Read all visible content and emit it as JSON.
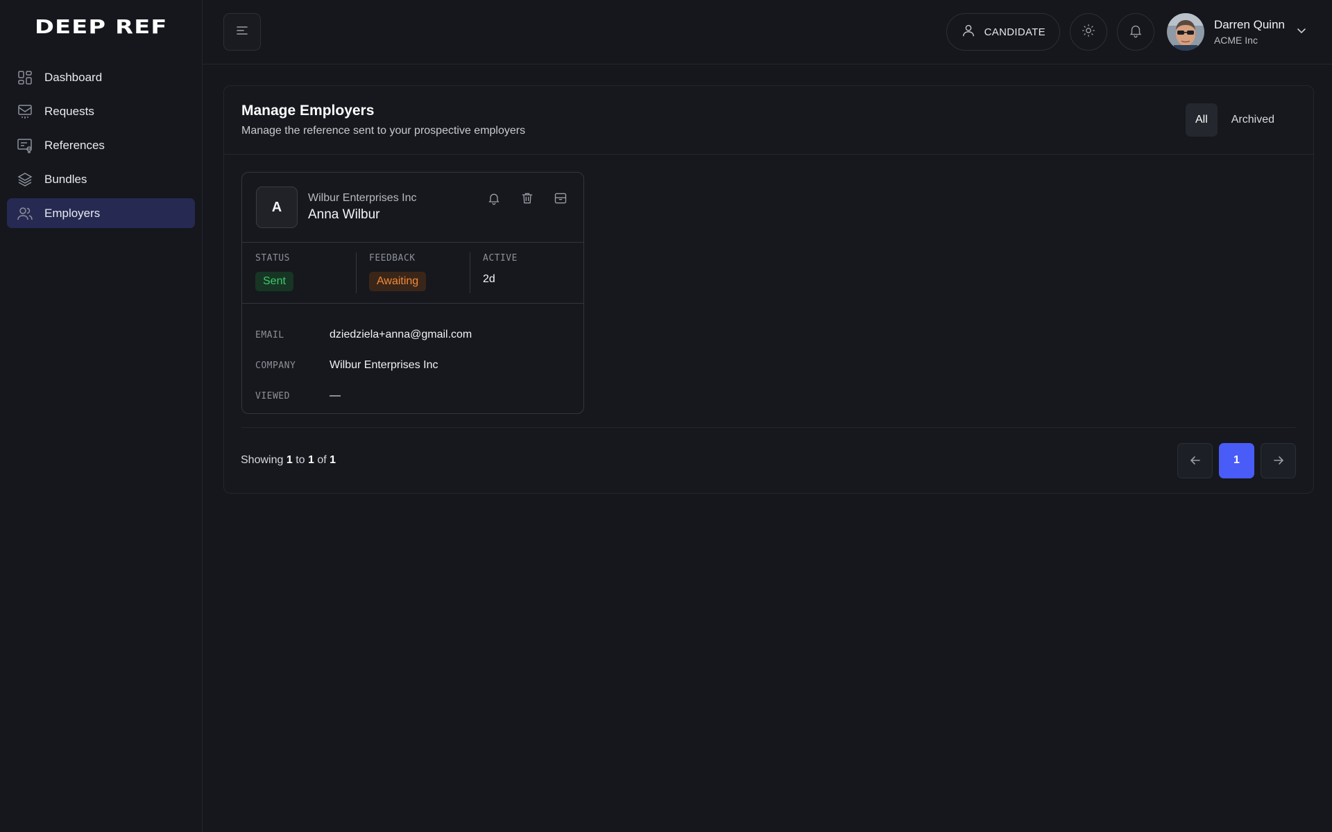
{
  "app": {
    "logo": "DEEP REF"
  },
  "sidebar": {
    "items": [
      {
        "label": "Dashboard",
        "icon": "dashboard-icon"
      },
      {
        "label": "Requests",
        "icon": "inbox-icon"
      },
      {
        "label": "References",
        "icon": "certificate-icon"
      },
      {
        "label": "Bundles",
        "icon": "layers-icon"
      },
      {
        "label": "Employers",
        "icon": "users-icon",
        "active": true
      }
    ]
  },
  "topbar": {
    "role_label": "CANDIDATE",
    "user": {
      "name": "Darren Quinn",
      "org": "ACME Inc"
    }
  },
  "panel": {
    "title": "Manage Employers",
    "subtitle": "Manage the reference sent to your prospective employers",
    "filters": [
      "All",
      "Archived"
    ],
    "active_filter": "All"
  },
  "employers": [
    {
      "initial": "A",
      "company": "Wilbur Enterprises Inc",
      "name": "Anna Wilbur",
      "stats": {
        "status_label": "STATUS",
        "status": "Sent",
        "feedback_label": "FEEDBACK",
        "feedback": "Awaiting",
        "active_label": "ACTIVE",
        "active": "2d"
      },
      "details": {
        "email_label": "EMAIL",
        "email": "dziedziela+anna@gmail.com",
        "company_label": "COMPANY",
        "company": "Wilbur Enterprises Inc",
        "viewed_label": "VIEWED",
        "viewed": "—"
      }
    }
  ],
  "pagination": {
    "prefix": "Showing",
    "from": "1",
    "to_word": "to",
    "to": "1",
    "of_word": "of",
    "total": "1",
    "current_page": "1"
  },
  "colors": {
    "accent": "#4a5cf7",
    "active_nav": "#262a52",
    "status_sent": "#3fca6b",
    "feedback_awaiting": "#f08a3c"
  }
}
